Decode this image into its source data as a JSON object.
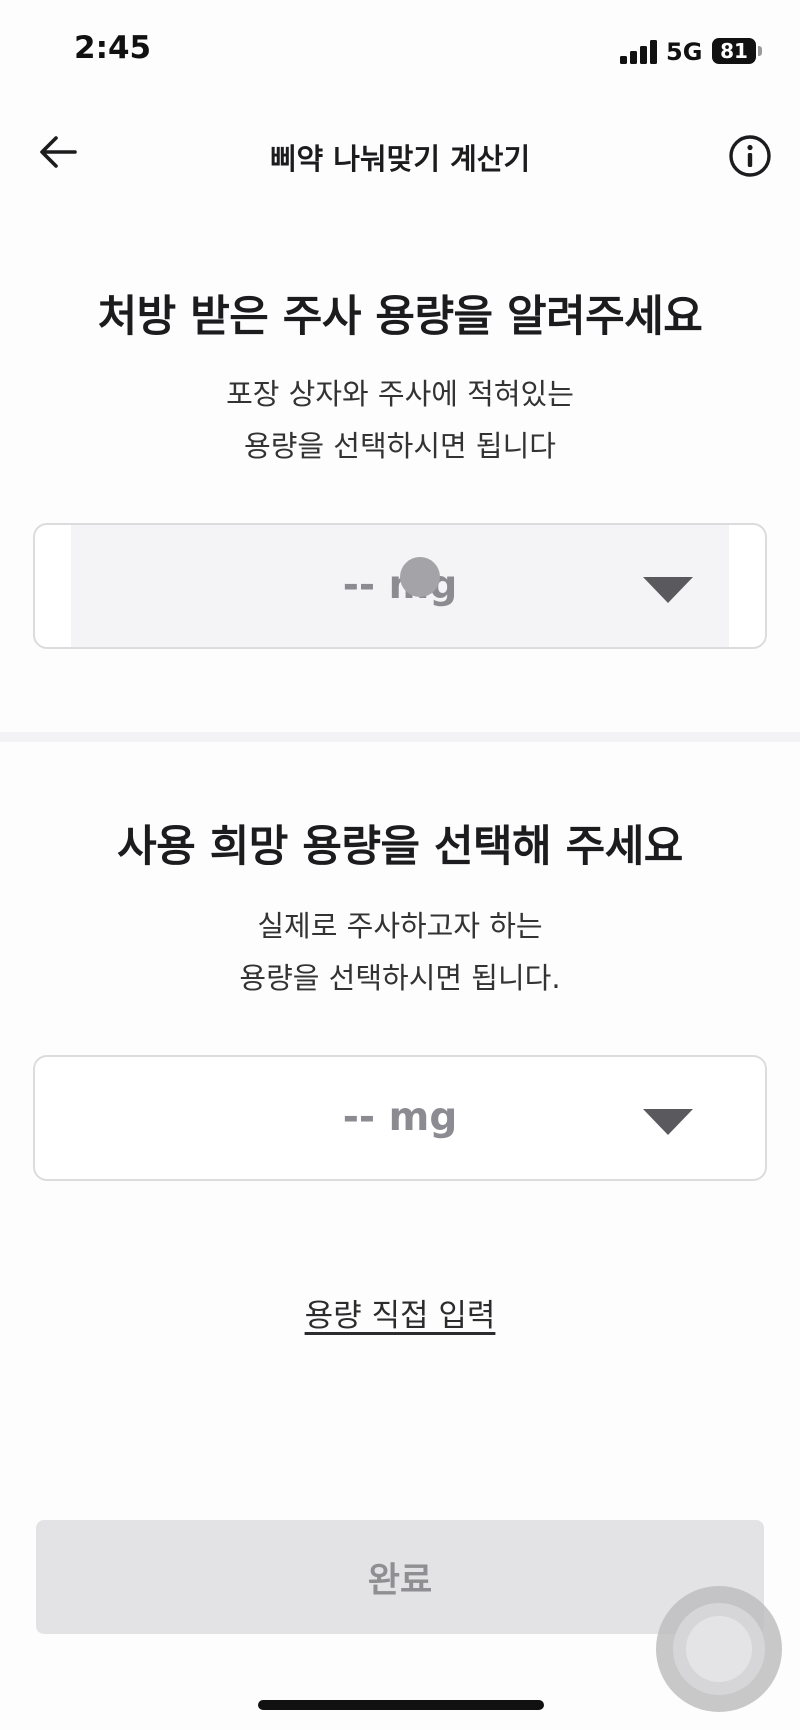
{
  "status_bar": {
    "time": "2:45",
    "network": "5G",
    "battery": "81"
  },
  "nav": {
    "title": "삐약 나눠맞기 계산기",
    "back_icon": "arrow-left-icon",
    "info_icon": "info-circle-icon"
  },
  "section_prescribed": {
    "heading": "처방 받은 주사 용량을 알려주세요",
    "sub_line1": "포장 상자와 주사에 적혀있는",
    "sub_line2": "용량을 선택하시면 됩니다",
    "select_value": "-- mg"
  },
  "section_desired": {
    "heading": "사용 희망 용량을 선택해 주세요",
    "sub_line1": "실제로 주사하고자 하는",
    "sub_line2": "용량을 선택하시면 됩니다.",
    "select_value": "-- mg"
  },
  "direct_input_link": "용량 직접 입력",
  "done_button": "완료",
  "colors": {
    "text_primary": "#1c1c1e",
    "placeholder": "#8b8b91",
    "button_disabled_bg": "#e3e3e6",
    "button_disabled_text": "#8e8e93",
    "border": "#dcdcdf"
  }
}
